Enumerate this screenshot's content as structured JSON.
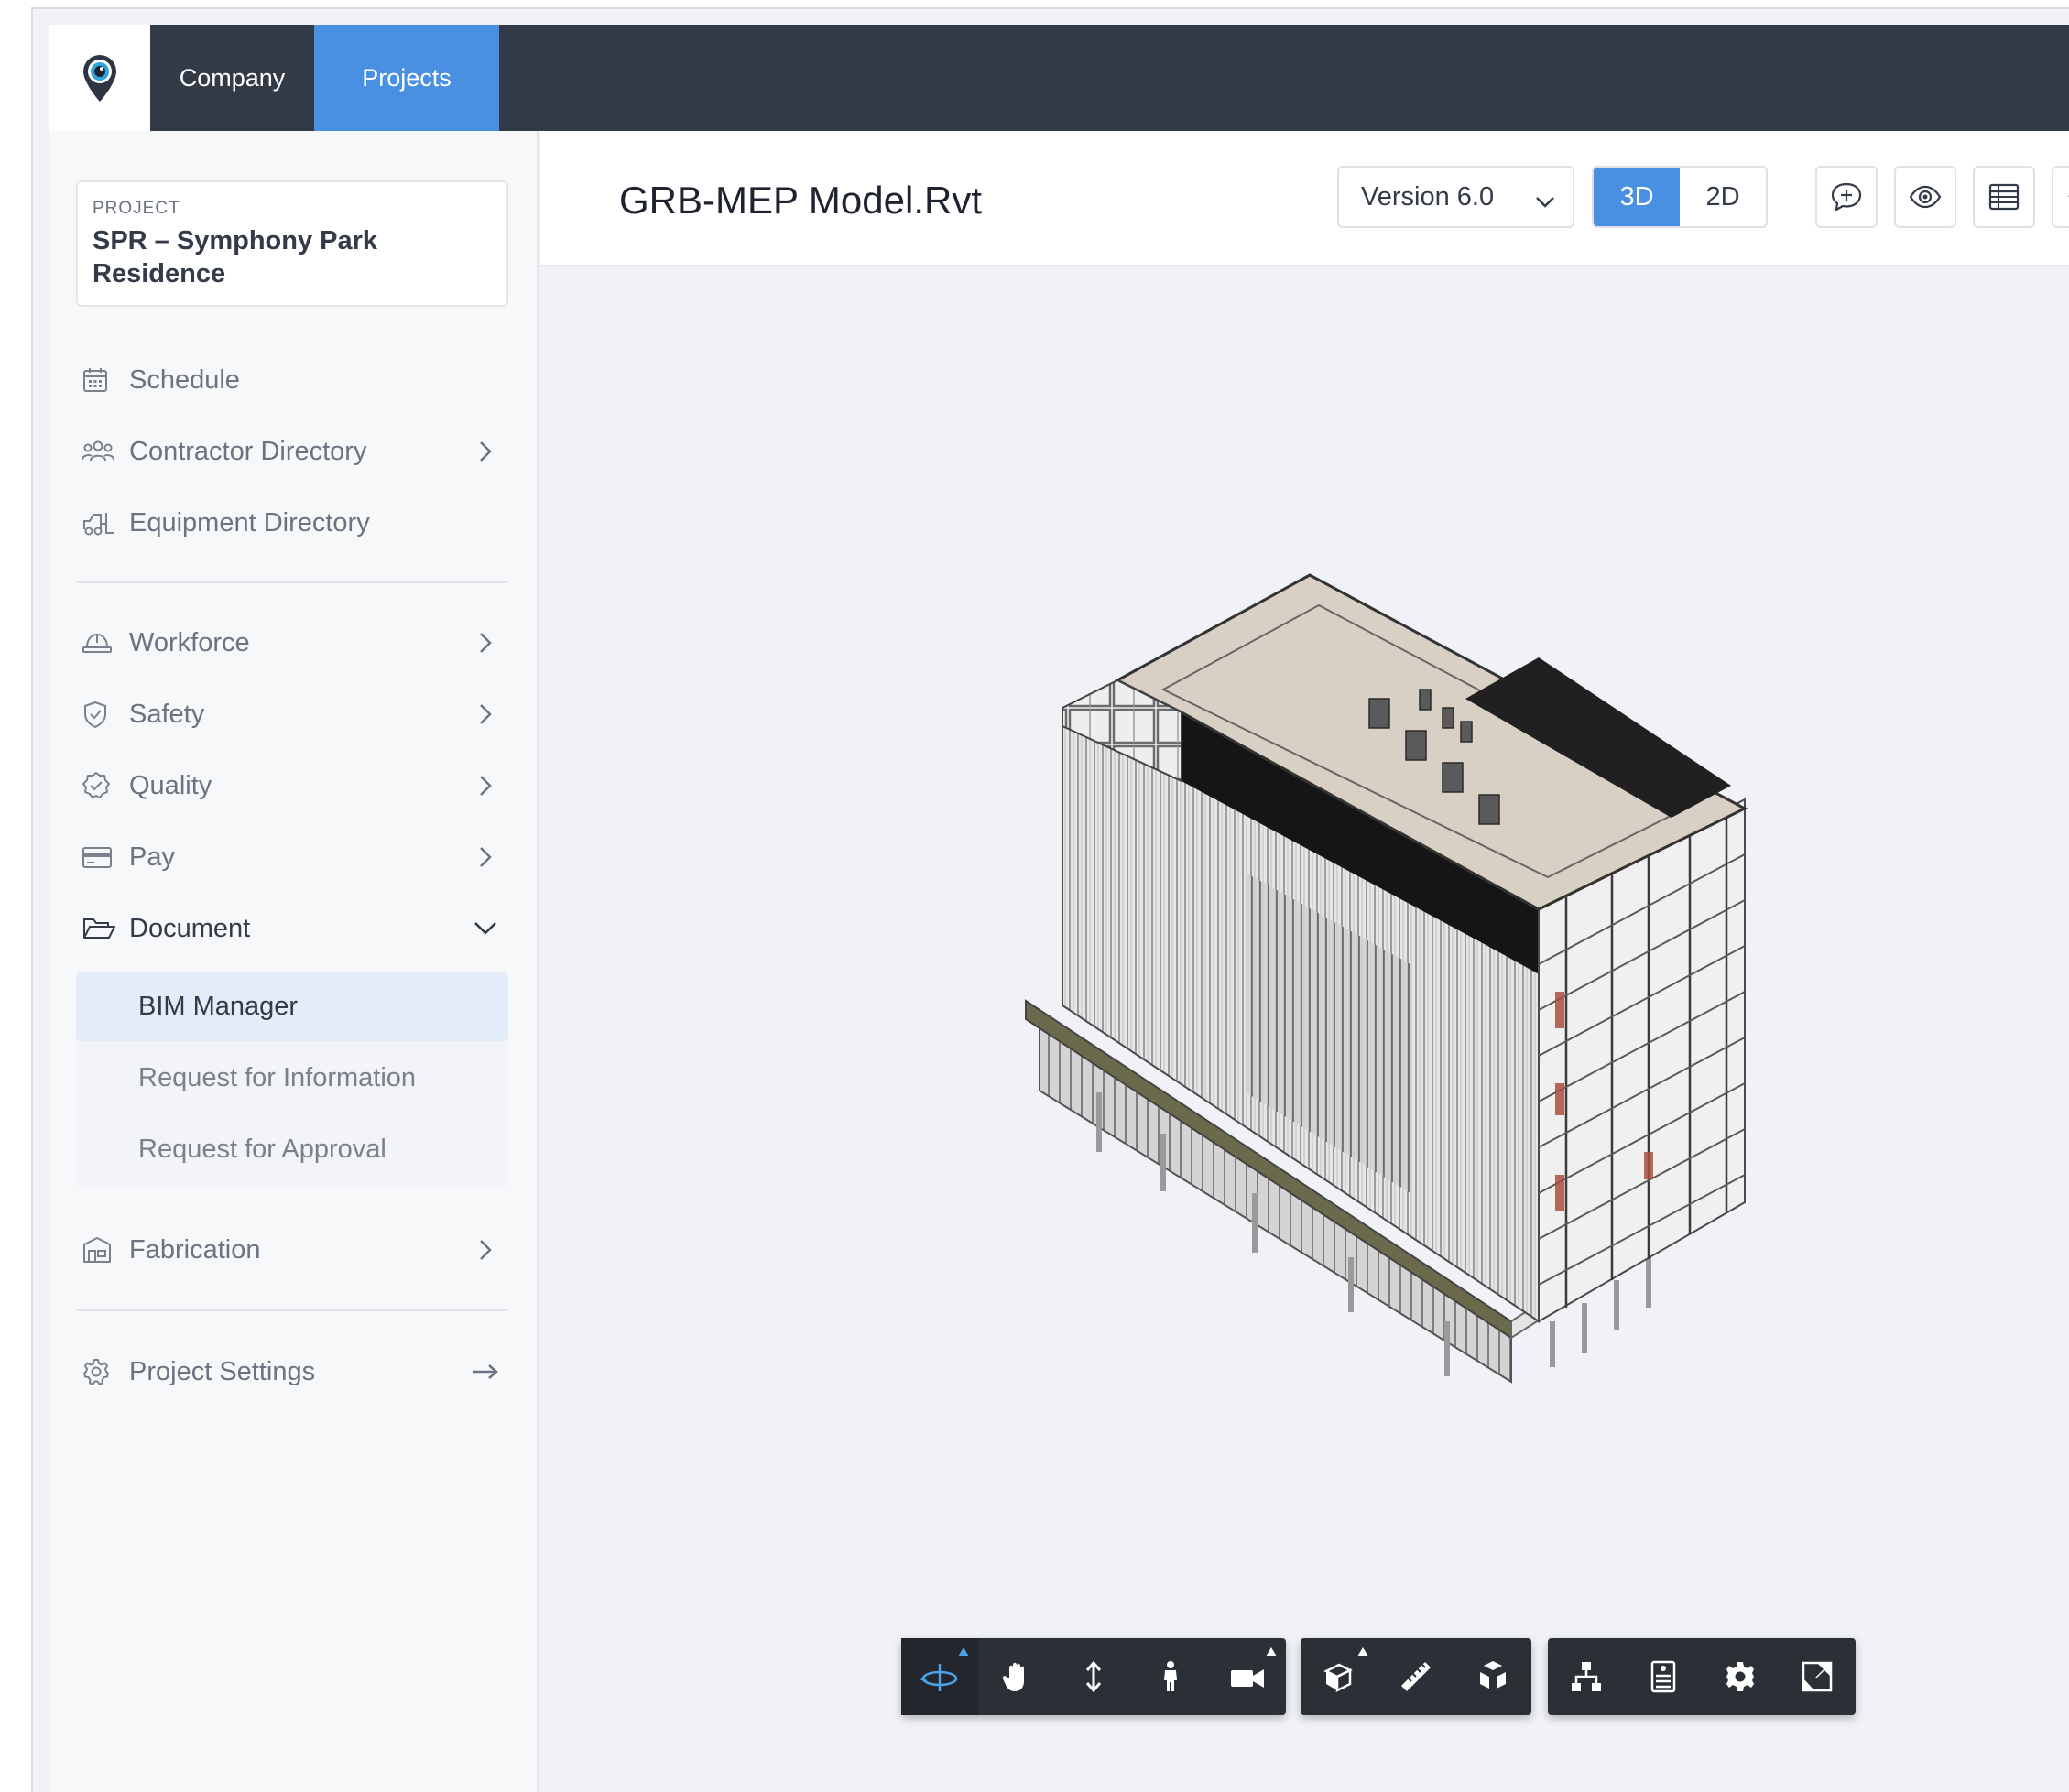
{
  "topbar": {
    "company_label": "Company",
    "projects_label": "Projects"
  },
  "project": {
    "label": "PROJECT",
    "name": "SPR – Symphony Park Residence"
  },
  "sidebar": {
    "items": [
      {
        "label": "Schedule",
        "icon": "calendar-icon"
      },
      {
        "label": "Contractor Directory",
        "icon": "people-icon"
      },
      {
        "label": "Equipment Directory",
        "icon": "forklift-icon"
      },
      {
        "label": "Workforce",
        "icon": "hardhat-icon"
      },
      {
        "label": "Safety",
        "icon": "shield-check-icon"
      },
      {
        "label": "Quality",
        "icon": "badge-check-icon"
      },
      {
        "label": "Pay",
        "icon": "credit-card-icon"
      },
      {
        "label": "Document",
        "icon": "folder-open-icon"
      },
      {
        "label": "Fabrication",
        "icon": "factory-icon"
      },
      {
        "label": "Project Settings",
        "icon": "gear-icon"
      }
    ],
    "document_sub": [
      {
        "label": "BIM Manager"
      },
      {
        "label": "Request for Information"
      },
      {
        "label": "Request for Approval"
      }
    ]
  },
  "header": {
    "title": "GRB-MEP Model.Rvt",
    "version": "Version 6.0",
    "view_3d": "3D",
    "view_2d": "2D"
  },
  "colors": {
    "accent": "#4a90e2",
    "topbar": "#323947",
    "toolbar": "#2b2f36"
  }
}
